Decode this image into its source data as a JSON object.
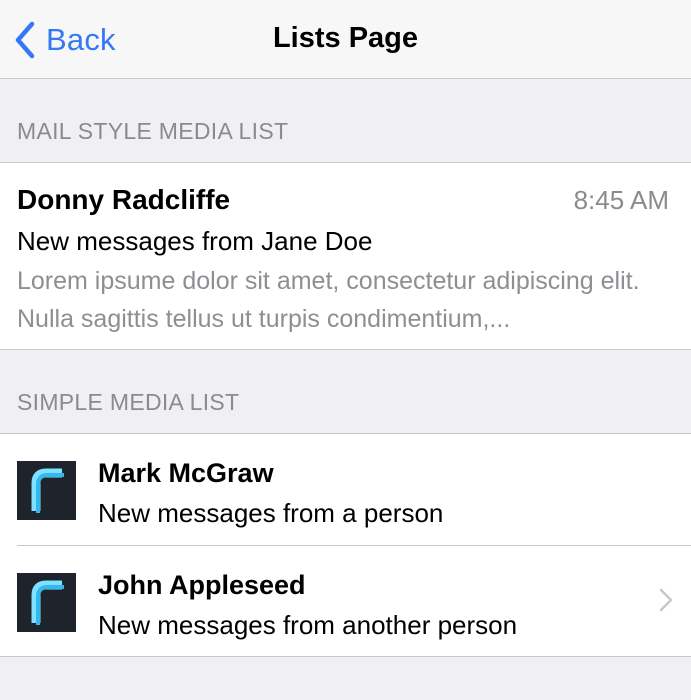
{
  "navbar": {
    "back_label": "Back",
    "title": "Lists Page",
    "back_icon": "chevron-left-icon",
    "accent_color": "#3478f6"
  },
  "mail_section": {
    "header": "MAIL STYLE MEDIA LIST",
    "items": [
      {
        "name": "Donny Radcliffe",
        "time": "8:45 AM",
        "subject": "New messages from Jane Doe",
        "text": "Lorem ipsume dolor sit amet, consectetur adipiscing elit. Nulla sagittis tellus ut turpis condimentium,..."
      }
    ]
  },
  "simple_section": {
    "header": "SIMPLE MEDIA LIST",
    "items": [
      {
        "title": "Mark McGraw",
        "subtitle": "New messages from a person",
        "icon": "app-logo-icon",
        "has_chevron": false
      },
      {
        "title": "John Appleseed",
        "subtitle": "New messages from another person",
        "icon": "app-logo-icon",
        "has_chevron": true
      }
    ]
  }
}
